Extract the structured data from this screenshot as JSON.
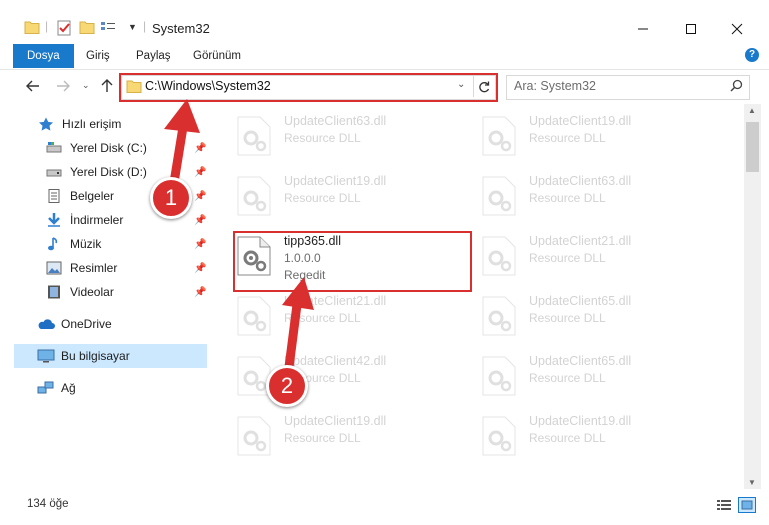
{
  "window": {
    "title": "System32",
    "minimize": "—",
    "maximize": "☐",
    "close": "✕"
  },
  "ribbon": {
    "tabs": [
      "Dosya",
      "Giriş",
      "Paylaş",
      "Görünüm"
    ]
  },
  "address": {
    "path": "C:\\Windows\\System32"
  },
  "search": {
    "placeholder": "Ara: System32"
  },
  "nav": {
    "quick_access": "Hızlı erişim",
    "items": [
      "Yerel Disk (C:)",
      "Yerel Disk (D:)",
      "Belgeler",
      "İndirmeler",
      "Müzik",
      "Resimler",
      "Videolar"
    ],
    "onedrive": "OneDrive",
    "this_pc": "Bu bilgisayar",
    "network": "Ağ"
  },
  "files": {
    "left": [
      {
        "name": "UpdateClient63.dll",
        "desc": "Resource DLL"
      },
      {
        "name": "UpdateClient19.dll",
        "desc": "Resource DLL"
      },
      {
        "name": "tipp365.dll",
        "version": "1.0.0.0",
        "desc": "Regedit"
      },
      {
        "name": "UpdateClient21.dll",
        "desc": "Resource DLL"
      },
      {
        "name": "UpdateClient42.dll",
        "desc": "Resource DLL"
      },
      {
        "name": "UpdateClient19.dll",
        "desc": "Resource DLL"
      }
    ],
    "right": [
      {
        "name": "UpdateClient19.dll",
        "desc": "Resource DLL"
      },
      {
        "name": "UpdateClient63.dll",
        "desc": "Resource DLL"
      },
      {
        "name": "UpdateClient21.dll",
        "desc": "Resource DLL"
      },
      {
        "name": "UpdateClient65.dll",
        "desc": "Resource DLL"
      },
      {
        "name": "UpdateClient65.dll",
        "desc": "Resource DLL"
      },
      {
        "name": "UpdateClient19.dll",
        "desc": "Resource DLL"
      }
    ]
  },
  "status": {
    "count": "134 öğe"
  },
  "annotations": {
    "step1": "1",
    "step2": "2",
    "color": "#d9302f"
  },
  "colors": {
    "accent": "#1979ca",
    "selection": "#cce8ff"
  }
}
